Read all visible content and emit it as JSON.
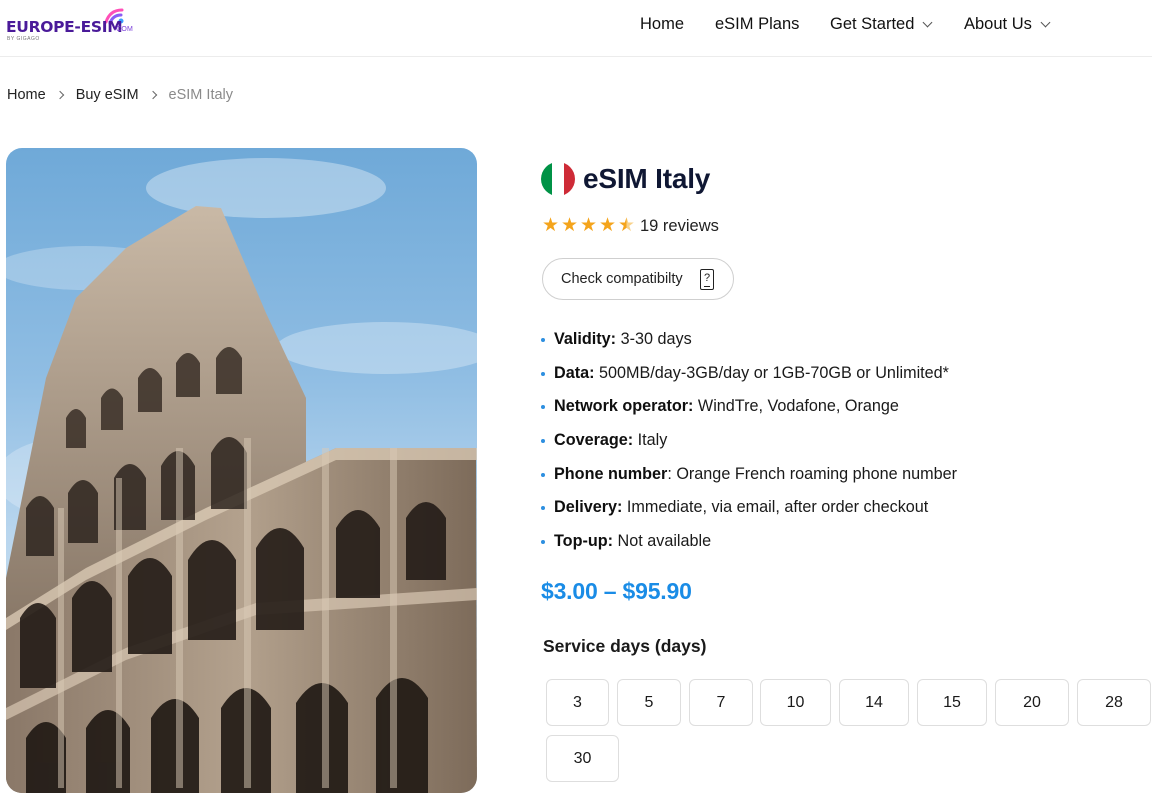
{
  "header": {
    "logo": {
      "name": "EUROPE-ESIM",
      "part1": "EUROPE-",
      "part2": "ESIM",
      "suffix": ".COM",
      "byline": "BY GIGAGO"
    },
    "nav": [
      {
        "label": "Home",
        "has_dropdown": false
      },
      {
        "label": "eSIM Plans",
        "has_dropdown": false
      },
      {
        "label": "Get Started",
        "has_dropdown": true
      },
      {
        "label": "About Us",
        "has_dropdown": true
      }
    ]
  },
  "breadcrumb": [
    {
      "label": "Home"
    },
    {
      "label": "Buy eSIM"
    },
    {
      "label": "eSIM Italy",
      "current": true
    }
  ],
  "product": {
    "title": "eSIM Italy",
    "flag_colors": [
      "#009246",
      "#ffffff",
      "#ce2b37"
    ],
    "rating": 4.5,
    "rating_max": 5,
    "reviews_label": "19 reviews",
    "compatibility_button": "Check compatibilty",
    "features": [
      {
        "label": "Validity:",
        "value": " 3-30 days"
      },
      {
        "label": "Data:",
        "value": " 500MB/day-3GB/day or 1GB-70GB or Unlimited*"
      },
      {
        "label": "Network operator:",
        "value": " WindTre, Vodafone, Orange"
      },
      {
        "label": "Coverage:",
        "value": " Italy"
      },
      {
        "label": "Phone number",
        "value": ": Orange French roaming phone number"
      },
      {
        "label": "Delivery:",
        "value": " Immediate, via email, after order checkout"
      },
      {
        "label": "Top-up:",
        "value": " Not available"
      }
    ],
    "price_range": "$3.00 – $95.90",
    "service_days_label": "Service days (days)",
    "service_days": [
      "3",
      "5",
      "7",
      "10",
      "14",
      "15",
      "20",
      "28",
      "30"
    ]
  },
  "colors": {
    "accent_blue": "#1a8ce6",
    "bullet_blue": "#2d8fe0",
    "star_orange": "#f4a41c",
    "title_navy": "#0f1733",
    "logo_purple": "#4a1a99"
  },
  "icons": {
    "nav_dropdown": "chevron-down-icon",
    "breadcrumb_separator": "chevron-right-icon",
    "compatibility": "phone-question-icon",
    "rating": "star-icon"
  }
}
